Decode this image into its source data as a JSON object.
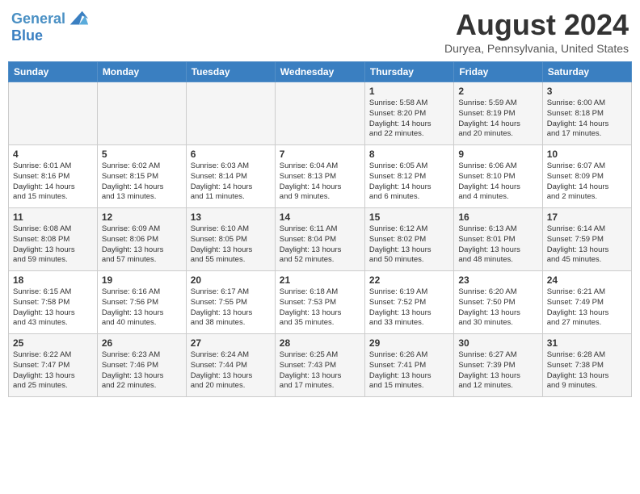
{
  "header": {
    "logo_line1": "General",
    "logo_line2": "Blue",
    "month": "August 2024",
    "location": "Duryea, Pennsylvania, United States"
  },
  "days_of_week": [
    "Sunday",
    "Monday",
    "Tuesday",
    "Wednesday",
    "Thursday",
    "Friday",
    "Saturday"
  ],
  "weeks": [
    [
      {
        "day": "",
        "info": ""
      },
      {
        "day": "",
        "info": ""
      },
      {
        "day": "",
        "info": ""
      },
      {
        "day": "",
        "info": ""
      },
      {
        "day": "1",
        "info": "Sunrise: 5:58 AM\nSunset: 8:20 PM\nDaylight: 14 hours\nand 22 minutes."
      },
      {
        "day": "2",
        "info": "Sunrise: 5:59 AM\nSunset: 8:19 PM\nDaylight: 14 hours\nand 20 minutes."
      },
      {
        "day": "3",
        "info": "Sunrise: 6:00 AM\nSunset: 8:18 PM\nDaylight: 14 hours\nand 17 minutes."
      }
    ],
    [
      {
        "day": "4",
        "info": "Sunrise: 6:01 AM\nSunset: 8:16 PM\nDaylight: 14 hours\nand 15 minutes."
      },
      {
        "day": "5",
        "info": "Sunrise: 6:02 AM\nSunset: 8:15 PM\nDaylight: 14 hours\nand 13 minutes."
      },
      {
        "day": "6",
        "info": "Sunrise: 6:03 AM\nSunset: 8:14 PM\nDaylight: 14 hours\nand 11 minutes."
      },
      {
        "day": "7",
        "info": "Sunrise: 6:04 AM\nSunset: 8:13 PM\nDaylight: 14 hours\nand 9 minutes."
      },
      {
        "day": "8",
        "info": "Sunrise: 6:05 AM\nSunset: 8:12 PM\nDaylight: 14 hours\nand 6 minutes."
      },
      {
        "day": "9",
        "info": "Sunrise: 6:06 AM\nSunset: 8:10 PM\nDaylight: 14 hours\nand 4 minutes."
      },
      {
        "day": "10",
        "info": "Sunrise: 6:07 AM\nSunset: 8:09 PM\nDaylight: 14 hours\nand 2 minutes."
      }
    ],
    [
      {
        "day": "11",
        "info": "Sunrise: 6:08 AM\nSunset: 8:08 PM\nDaylight: 13 hours\nand 59 minutes."
      },
      {
        "day": "12",
        "info": "Sunrise: 6:09 AM\nSunset: 8:06 PM\nDaylight: 13 hours\nand 57 minutes."
      },
      {
        "day": "13",
        "info": "Sunrise: 6:10 AM\nSunset: 8:05 PM\nDaylight: 13 hours\nand 55 minutes."
      },
      {
        "day": "14",
        "info": "Sunrise: 6:11 AM\nSunset: 8:04 PM\nDaylight: 13 hours\nand 52 minutes."
      },
      {
        "day": "15",
        "info": "Sunrise: 6:12 AM\nSunset: 8:02 PM\nDaylight: 13 hours\nand 50 minutes."
      },
      {
        "day": "16",
        "info": "Sunrise: 6:13 AM\nSunset: 8:01 PM\nDaylight: 13 hours\nand 48 minutes."
      },
      {
        "day": "17",
        "info": "Sunrise: 6:14 AM\nSunset: 7:59 PM\nDaylight: 13 hours\nand 45 minutes."
      }
    ],
    [
      {
        "day": "18",
        "info": "Sunrise: 6:15 AM\nSunset: 7:58 PM\nDaylight: 13 hours\nand 43 minutes."
      },
      {
        "day": "19",
        "info": "Sunrise: 6:16 AM\nSunset: 7:56 PM\nDaylight: 13 hours\nand 40 minutes."
      },
      {
        "day": "20",
        "info": "Sunrise: 6:17 AM\nSunset: 7:55 PM\nDaylight: 13 hours\nand 38 minutes."
      },
      {
        "day": "21",
        "info": "Sunrise: 6:18 AM\nSunset: 7:53 PM\nDaylight: 13 hours\nand 35 minutes."
      },
      {
        "day": "22",
        "info": "Sunrise: 6:19 AM\nSunset: 7:52 PM\nDaylight: 13 hours\nand 33 minutes."
      },
      {
        "day": "23",
        "info": "Sunrise: 6:20 AM\nSunset: 7:50 PM\nDaylight: 13 hours\nand 30 minutes."
      },
      {
        "day": "24",
        "info": "Sunrise: 6:21 AM\nSunset: 7:49 PM\nDaylight: 13 hours\nand 27 minutes."
      }
    ],
    [
      {
        "day": "25",
        "info": "Sunrise: 6:22 AM\nSunset: 7:47 PM\nDaylight: 13 hours\nand 25 minutes."
      },
      {
        "day": "26",
        "info": "Sunrise: 6:23 AM\nSunset: 7:46 PM\nDaylight: 13 hours\nand 22 minutes."
      },
      {
        "day": "27",
        "info": "Sunrise: 6:24 AM\nSunset: 7:44 PM\nDaylight: 13 hours\nand 20 minutes."
      },
      {
        "day": "28",
        "info": "Sunrise: 6:25 AM\nSunset: 7:43 PM\nDaylight: 13 hours\nand 17 minutes."
      },
      {
        "day": "29",
        "info": "Sunrise: 6:26 AM\nSunset: 7:41 PM\nDaylight: 13 hours\nand 15 minutes."
      },
      {
        "day": "30",
        "info": "Sunrise: 6:27 AM\nSunset: 7:39 PM\nDaylight: 13 hours\nand 12 minutes."
      },
      {
        "day": "31",
        "info": "Sunrise: 6:28 AM\nSunset: 7:38 PM\nDaylight: 13 hours\nand 9 minutes."
      }
    ]
  ]
}
